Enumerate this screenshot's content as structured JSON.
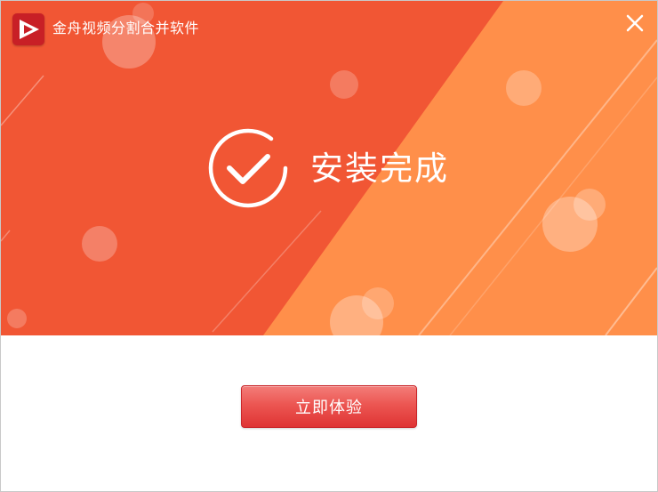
{
  "window": {
    "title": "金舟视频分割合并软件",
    "logo_icon": "play-triangle-logo-icon",
    "close_icon": "close-icon"
  },
  "banner": {
    "status_icon": "check-circle-icon",
    "status_text": "安装完成",
    "colors": {
      "primary": "#f15634",
      "secondary": "#ff8f4a",
      "text": "#ffffff"
    }
  },
  "actions": {
    "primary_label": "立即体验",
    "primary_color": "#e84040"
  }
}
